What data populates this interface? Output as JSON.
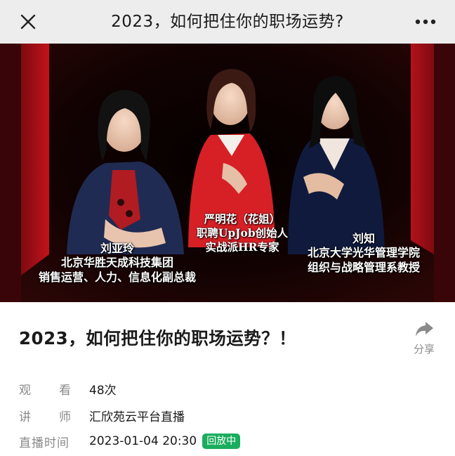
{
  "topbar": {
    "title": "2023，如何把住你的职场运势?",
    "close_icon": "close-icon",
    "more_icon": "more-horizontal-icon"
  },
  "poster": {
    "left_caption": [
      "刘亚玲",
      "北京华胜天成科技集团",
      "销售运营、人力、信息化副总裁"
    ],
    "center_caption": [
      "严明花（花姐）",
      "职聘UpJob创始人",
      "实战派HR专家"
    ],
    "right_caption": [
      "刘知",
      "北京大学光华管理学院",
      "组织与战略管理系教授"
    ]
  },
  "video": {
    "title": "2023，如何把住你的职场运势？！",
    "share_label": "分享",
    "share_icon": "share-arrow-icon",
    "meta": [
      {
        "label_a": "观",
        "label_b": "看",
        "value": "48次"
      },
      {
        "label_a": "讲",
        "label_b": "师",
        "value": "汇欣苑云平台直播"
      },
      {
        "label": "直播时间",
        "value": "2023-01-04 20:30",
        "badge": "回放中"
      }
    ]
  },
  "colors": {
    "topbar_bg": "#ededed",
    "badge_green": "#1aad5e",
    "poster_red": "#b5121b",
    "meta_label": "#8a8a8a"
  }
}
